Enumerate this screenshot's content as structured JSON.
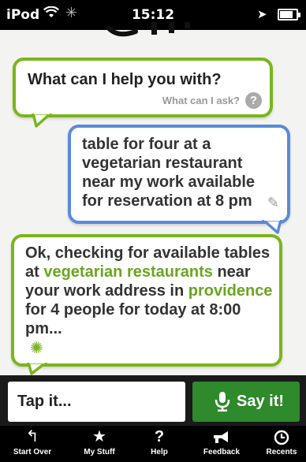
{
  "status_bar": {
    "carrier": "iPod",
    "time": "15:12"
  },
  "conversation": {
    "assistant_prompt": "What can I help you with?",
    "help_link": "What can I ask?",
    "user_query": "table for four at a vegetarian restaurant near my work available for reservation at 8 pm",
    "assistant_reply": {
      "part1": "Ok, checking for available tables at ",
      "highlight1": "vegetarian restaurants",
      "part2": " near your work address in ",
      "highlight2": "providence",
      "part3": " for 4 people for today at 8:00 pm..."
    }
  },
  "input_bar": {
    "tap_label": "Tap it...",
    "say_label": "Say it!"
  },
  "tab_bar": {
    "items": [
      {
        "label": "Start Over",
        "icon": "start-over-icon"
      },
      {
        "label": "My Stuff",
        "icon": "star-icon"
      },
      {
        "label": "Help",
        "icon": "question-icon"
      },
      {
        "label": "Feedback",
        "icon": "megaphone-icon"
      },
      {
        "label": "Recents",
        "icon": "clock-icon"
      }
    ]
  },
  "colors": {
    "accent_green": "#7ab51d",
    "user_blue": "#5b8ad6",
    "say_button": "#2f8a2c"
  }
}
